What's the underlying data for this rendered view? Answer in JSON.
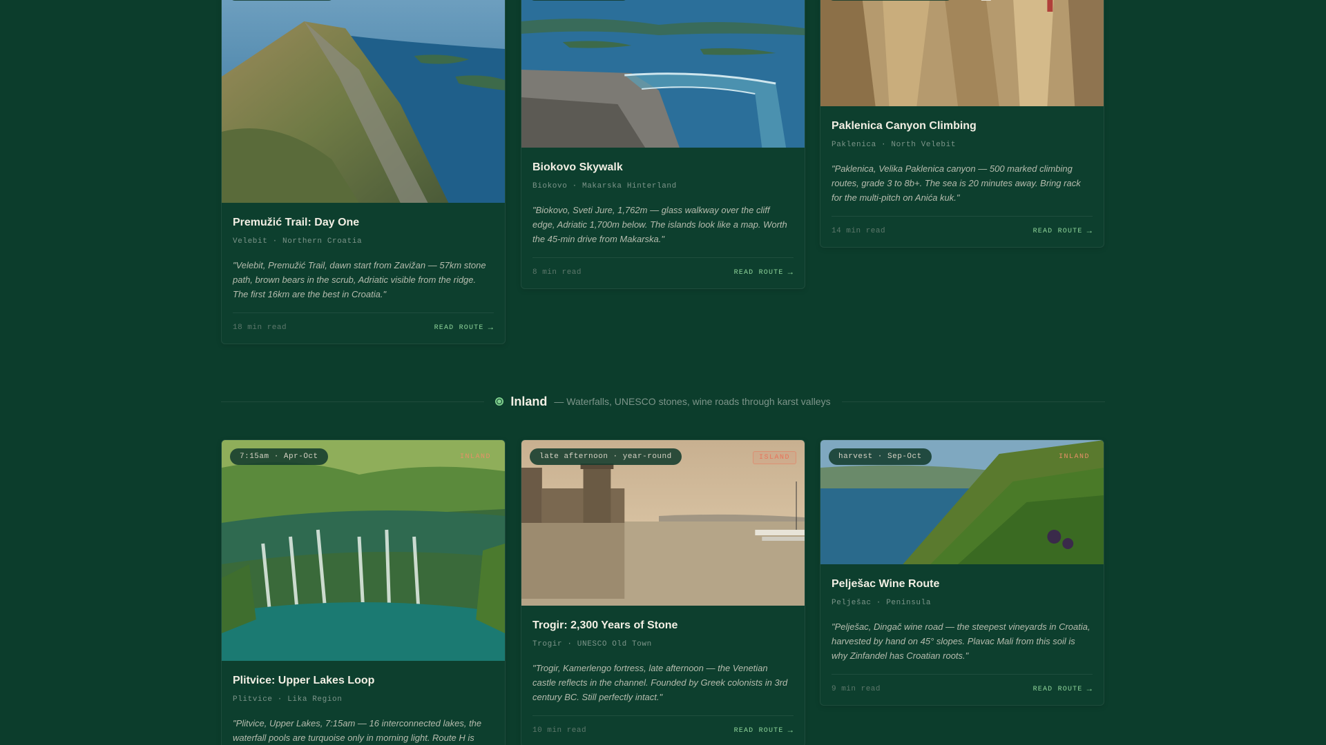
{
  "top_cards": [
    {
      "title": "Premužić Trail: Day One",
      "location": "Velebit · Northern Croatia",
      "quote": "\"Velebit, Premužić Trail, dawn start from Zavižan — 57km stone path, brown bears in the scrub, Adriatic visible from the ridge. The first 16km are the best in Croatia.\"",
      "read_time": "18 min read",
      "cta": "READ ROUTE"
    },
    {
      "title": "Biokovo Skywalk",
      "location": "Biokovo · Makarska Hinterland",
      "quote": "\"Biokovo, Sveti Jure, 1,762m — glass walkway over the cliff edge, Adriatic 1,700m below. The islands look like a map. Worth the 45-min drive from Makarska.\"",
      "read_time": "8 min read",
      "cta": "READ ROUTE"
    },
    {
      "title": "Paklenica Canyon Climbing",
      "location": "Paklenica · North Velebit",
      "quote": "\"Paklenica, Velika Paklenica canyon — 500 marked climbing routes, grade 3 to 8b+. The sea is 20 minutes away. Bring rack for the multi-pitch on Anića kuk.\"",
      "read_time": "14 min read",
      "cta": "READ ROUTE"
    }
  ],
  "section": {
    "title": "Inland",
    "subtitle": "— Waterfalls, UNESCO stones, wine roads through karst valleys"
  },
  "bottom_cards": [
    {
      "time": "7:15am · Apr-Oct",
      "tag": "INLAND",
      "title": "Plitvice: Upper Lakes Loop",
      "location": "Plitvice · Lika Region",
      "quote": "\"Plitvice, Upper Lakes, 7:15am — 16 interconnected lakes, the waterfall pools are turquoise only in morning light. Route H is"
    },
    {
      "time": "late afternoon · year-round",
      "tag": "ISLAND",
      "title": "Trogir: 2,300 Years of Stone",
      "location": "Trogir · UNESCO Old Town",
      "quote": "\"Trogir, Kamerlengo fortress, late afternoon — the Venetian castle reflects in the channel. Founded by Greek colonists in 3rd century BC. Still perfectly intact.\"",
      "read_time": "10 min read",
      "cta": "READ ROUTE"
    },
    {
      "time": "harvest · Sep-Oct",
      "tag": "INLAND",
      "title": "Pelješac Wine Route",
      "location": "Pelješac · Peninsula",
      "quote": "\"Pelješac, Dingač wine road — the steepest vineyards in Croatia, harvested by hand on 45° slopes. Plavac Mali from this soil is why Zinfandel has Croatian roots.\"",
      "read_time": "9 min read",
      "cta": "READ ROUTE"
    }
  ],
  "icons": {
    "arrow": "arrow-right-icon",
    "section_dot": "section-dot-icon"
  },
  "colors": {
    "background": "#0c3d2c",
    "accent": "#8fd49a",
    "tag_orange": "#e8745a"
  }
}
